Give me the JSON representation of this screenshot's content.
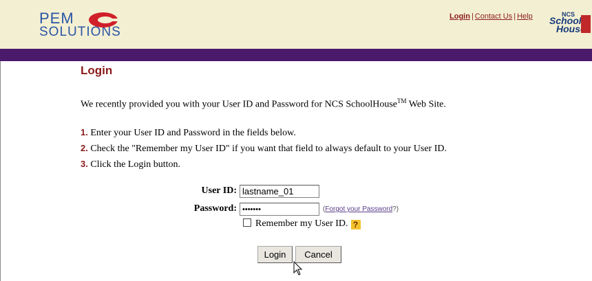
{
  "header": {
    "logo_line1": "PEM",
    "logo_line2": "SOLUTIONS",
    "links": [
      "Login",
      "Contact Us",
      "Help"
    ],
    "partner_logo": {
      "ncs": "NCS",
      "line1": "School",
      "line2": "House"
    }
  },
  "page": {
    "title": "Login",
    "intro_prefix": "We recently provided you with your User ID and Password for NCS SchoolHouse",
    "intro_tm": "TM",
    "intro_suffix": " Web Site.",
    "steps": [
      {
        "num": "1.",
        "text": "Enter your User ID and Password in the fields below."
      },
      {
        "num": "2.",
        "text": "Check the \"Remember my User ID\" if you want that field to always default to your User ID."
      },
      {
        "num": "3.",
        "text": "Click the Login button."
      }
    ]
  },
  "form": {
    "user_id_label": "User ID:",
    "user_id_value": "lastname_01",
    "password_label": "Password:",
    "password_value": "•••••••",
    "forgot_open": "(",
    "forgot_link": "Forgot your Password",
    "forgot_close": "?)",
    "remember_label": "Remember my User ID.",
    "help_icon": "?",
    "login_button": "Login",
    "cancel_button": "Cancel"
  },
  "colors": {
    "header_bg": "#f3efd2",
    "purple_bar": "#4b1a6b",
    "accent": "#8a1a1a",
    "logo_blue": "#2a55a6"
  }
}
